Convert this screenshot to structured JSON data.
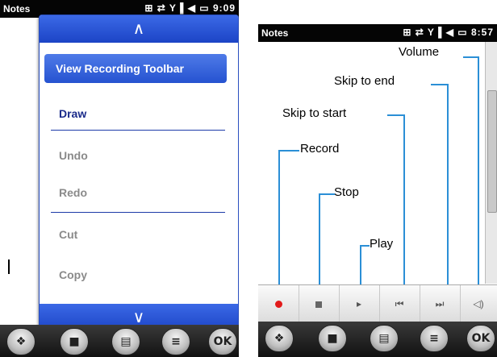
{
  "left": {
    "status_title": "Notes",
    "status_time": "9:09",
    "status_icons": "⊞ ⇄ Y▐ ◀ ▭",
    "menu": {
      "items": [
        {
          "label": "View Recording Toolbar",
          "state": "highlighted"
        },
        {
          "label": "Draw",
          "state": "enabled"
        },
        {
          "label": "Undo",
          "state": "disabled"
        },
        {
          "label": "Redo",
          "state": "disabled"
        },
        {
          "label": "Cut",
          "state": "disabled"
        },
        {
          "label": "Copy",
          "state": "disabled"
        }
      ],
      "scroll_up_icon": "∧",
      "scroll_down_icon": "∨"
    },
    "taskbar": {
      "start": "❖",
      "notes": "■",
      "keyboard": "▤",
      "menu": "≡",
      "ok": "OK"
    }
  },
  "right": {
    "status_title": "Notes",
    "status_time": "8:57",
    "status_icons": "⊞ ⇄ Y▐ ◀ ▭",
    "callouts": {
      "volume": "Volume",
      "skip_to_end": "Skip to end",
      "skip_to_start": "Skip to start",
      "record": "Record",
      "stop": "Stop",
      "play": "Play"
    },
    "toolbar_icons": {
      "play": "▸",
      "skip_start": "⏮",
      "skip_end": "⏭",
      "volume": "◁)"
    },
    "taskbar": {
      "start": "❖",
      "new": "■",
      "keyboard": "▤",
      "menu": "≡",
      "ok": "OK"
    }
  },
  "colors": {
    "accent_blue": "#2552d0",
    "leader_blue": "#2b8fd6",
    "record_red": "#e21b1b"
  }
}
